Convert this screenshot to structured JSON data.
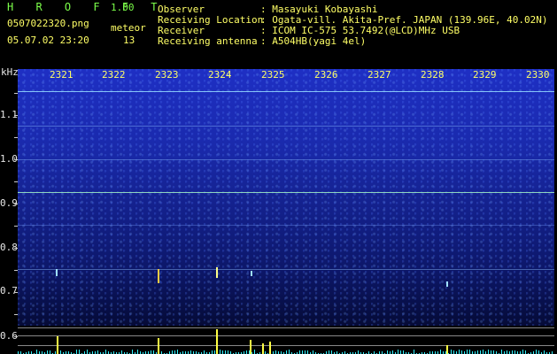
{
  "header": {
    "app_title": "H R O F F T",
    "version": "1.00",
    "filename": "0507022320.png",
    "meteor_label": "meteor",
    "datetime": "05.07.02 23:20",
    "meteor_count": "13"
  },
  "info": {
    "labels": [
      "Observer",
      "Receiving Location",
      "Receiver",
      "Receiving antenna"
    ],
    "values": [
      ": Masayuki Kobayashi",
      ": Ogata-vill. Akita-Pref. JAPAN (139.96E, 40.02N)",
      ": ICOM IC-575 53.7492(@LCD)MHz USB",
      ": A504HB(yagi 4el)"
    ]
  },
  "y_axis": {
    "unit": "kHz",
    "ticks": [
      "1.1",
      "1.0",
      "0.9",
      "0.8",
      "0.7",
      "0.6"
    ]
  },
  "time_labels": [
    "2321",
    "2322",
    "2323",
    "2324",
    "2325",
    "2326",
    "2327",
    "2328",
    "2329",
    "2330"
  ],
  "colors": {
    "title_green": "#7cff4a",
    "time_yellow": "#ffff66",
    "plot_blue": "#1a2aae",
    "spike_yellow": "#ffff44",
    "noise_cyan": "#2ff0ff"
  }
}
